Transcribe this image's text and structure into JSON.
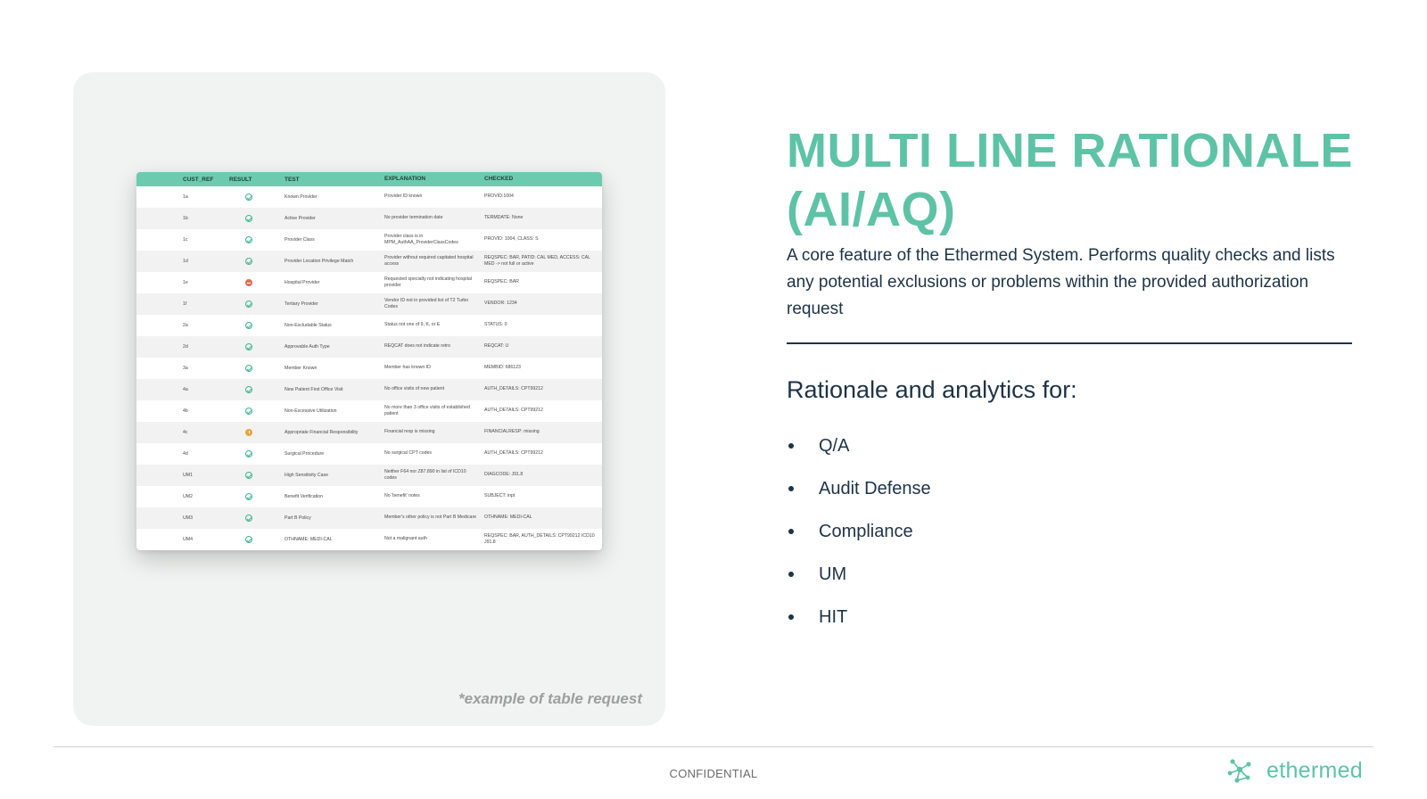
{
  "slide": {
    "title": "MULTI LINE RATIONALE (AI/AQ)",
    "description": "A core feature of the Ethermed System. Performs quality checks and lists any potential exclusions or problems within the provided authorization request",
    "subheading": "Rationale and analytics for:",
    "bullets": [
      "Q/A",
      "Audit Defense",
      "Compliance",
      "UM",
      "HIT"
    ],
    "caption": "*example of table request",
    "footer": "CONFIDENTIAL",
    "brand": "ethermed"
  },
  "colors": {
    "accent": "#5ec3a6",
    "header_green": "#6ccbae",
    "text_dark": "#1e3347",
    "pass": "#3fb68b",
    "fail": "#e06b5a",
    "warn": "#e9a53b"
  },
  "table": {
    "headers": [
      "CUST_REF",
      "RESULT",
      "TEST",
      "EXPLANATION",
      "CHECKED"
    ],
    "rows": [
      {
        "ref": "1a",
        "result": "pass",
        "test": "Known Provider",
        "explanation": "Provider ID known",
        "checked": "PROVID:1004"
      },
      {
        "ref": "1b",
        "result": "pass",
        "test": "Active Provider",
        "explanation": "No provider termination date",
        "checked": "TERMDATE: None"
      },
      {
        "ref": "1c",
        "result": "pass",
        "test": "Provider Class",
        "explanation": "Provider class is in MPM_AuthAA_ProviderClassCodes",
        "checked": "PROVID: 1004, CLASS: S"
      },
      {
        "ref": "1d",
        "result": "pass",
        "test": "Provider Location Privilege Match",
        "explanation": "Provider without required capitated hospital access",
        "checked": "REQSPEC: BAR, PATID: CAL MED, ACCESS: CAL MED -> not full or active"
      },
      {
        "ref": "1e",
        "result": "fail",
        "test": "Hospital Provider",
        "explanation": "Requested specialty not indicating hospital provider",
        "checked": "REQSPEC: BAR"
      },
      {
        "ref": "1f",
        "result": "pass",
        "test": "Tertiary Provider",
        "explanation": "Vendor ID not in provided list of T2 Turbo Codes",
        "checked": "VENDOR: 1234"
      },
      {
        "ref": "2a",
        "result": "pass",
        "test": "Non-Excludable Status",
        "explanation": "Status not one of 9, K, or E",
        "checked": "STATUS: 0"
      },
      {
        "ref": "2d",
        "result": "pass",
        "test": "Approvable Auth Type",
        "explanation": "REQCAT does not indicate retro",
        "checked": "REQCAT: U"
      },
      {
        "ref": "3a",
        "result": "pass",
        "test": "Member Known",
        "explanation": "Member has known ID",
        "checked": "MEMBID: 686123"
      },
      {
        "ref": "4a",
        "result": "pass",
        "test": "New Patient First Office Visit",
        "explanation": "No office visits of new patient",
        "checked": "AUTH_DETAILS: CPT99212"
      },
      {
        "ref": "4b",
        "result": "pass",
        "test": "Non-Excessive Utilization",
        "explanation": "No more than 3 office visits of established patient",
        "checked": "AUTH_DETAILS: CPT99212"
      },
      {
        "ref": "4c",
        "result": "warn",
        "test": "Appropriate Financial Responsibility",
        "explanation": "Financial resp is missing",
        "checked": "FINANCIALRESP: missing"
      },
      {
        "ref": "4d",
        "result": "pass",
        "test": "Surgical Procedure",
        "explanation": "No surgical CPT codes",
        "checked": "AUTH_DETAILS: CPT99212"
      },
      {
        "ref": "UM1",
        "result": "pass",
        "test": "High Sensitivity Case",
        "explanation": "Neither F64 nor Z87.890 in list of ICD10 codes",
        "checked": "DIAGCODE: J91.8"
      },
      {
        "ref": "UM2",
        "result": "pass",
        "test": "Benefit Verification",
        "explanation": "No 'benefit' notes",
        "checked": "SUBJECT: inpt"
      },
      {
        "ref": "UM3",
        "result": "pass",
        "test": "Part B Policy",
        "explanation": "Member's other policy is not Part B Medicare",
        "checked": "OTHNAME: MEDI-CAL"
      },
      {
        "ref": "UM4",
        "result": "pass",
        "test": "OTHNAME: MEDI-CAL",
        "explanation": "Not a malignant auth",
        "checked": "REQSPEC: BAR, AUTH_DETAILS: CPT99212 ICD10 J91.8"
      }
    ]
  }
}
